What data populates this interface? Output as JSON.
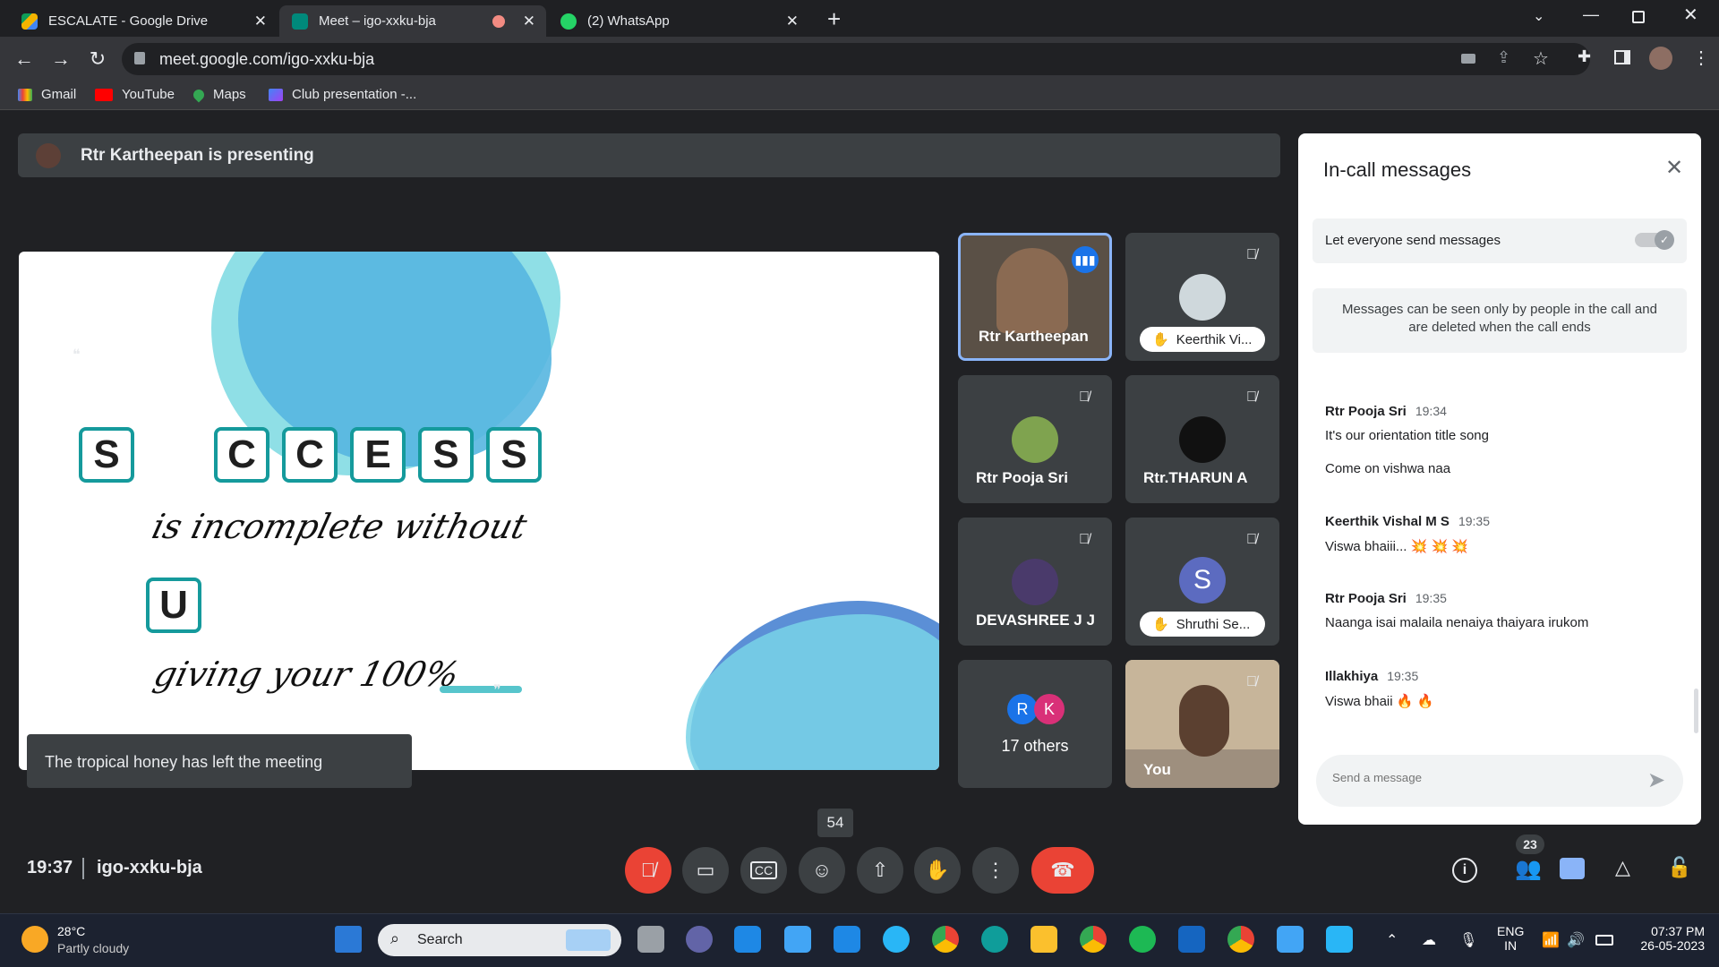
{
  "browser": {
    "tabs": [
      {
        "title": "ESCALATE - Google Drive",
        "close": "✕"
      },
      {
        "title": "Meet – igo-xxku-bja",
        "close": "✕"
      },
      {
        "title": "(2) WhatsApp",
        "close": "✕"
      }
    ],
    "new_tab": "+",
    "url": "meet.google.com/igo-xxku-bja",
    "bookmarks": [
      "Gmail",
      "YouTube",
      "Maps",
      "Club presentation -..."
    ]
  },
  "meet": {
    "presenting_banner": "Rtr Kartheepan is presenting",
    "slide": {
      "letters_row1": [
        "S",
        "C",
        "C",
        "E",
        "S",
        "S"
      ],
      "line1": "is incomplete without",
      "letter_u": "U",
      "line2": "giving your 100%"
    },
    "toast": "The tropical honey has left the meeting",
    "participants": [
      {
        "name": "Rtr Kartheepan"
      },
      {
        "name": "Keerthik Vi..."
      },
      {
        "name": "Rtr Pooja Sri"
      },
      {
        "name": "Rtr.THARUN A"
      },
      {
        "name": "DEVASHREE J J"
      },
      {
        "name": "Shruthi Se...",
        "initial": "S"
      },
      {
        "name": "17 others",
        "initials": [
          "R",
          "K"
        ]
      },
      {
        "name": "You"
      }
    ],
    "time": "19:37",
    "meeting_code": "igo-xxku-bja",
    "count_tooltip": "54",
    "people_badge": "23",
    "accent_red": "#ea4335",
    "accent_blue": "#8ab4f8"
  },
  "panel": {
    "title": "In-call messages",
    "toggle_label": "Let everyone send messages",
    "notice": "Messages can be seen only by people in the call and are deleted when the call ends",
    "messages": [
      {
        "sender": "Rtr Pooja Sri",
        "time": "19:34",
        "lines": [
          "It's our orientation title song",
          "Come on vishwa naa"
        ]
      },
      {
        "sender": "Keerthik Vishal M S",
        "time": "19:35",
        "lines": [
          "Viswa bhaiii... 💥 💥 💥"
        ]
      },
      {
        "sender": "Rtr Pooja Sri",
        "time": "19:35",
        "lines": [
          "Naanga isai malaila nenaiya thaiyara irukom"
        ]
      },
      {
        "sender": "Illakhiya",
        "time": "19:35",
        "lines": [
          "Viswa bhaii 🔥 🔥"
        ]
      }
    ],
    "input_placeholder": "Send a message"
  },
  "taskbar": {
    "weather_temp": "28°C",
    "weather_desc": "Partly cloudy",
    "search_label": "Search",
    "lang1": "ENG",
    "lang2": "IN",
    "clock_time": "07:37 PM",
    "clock_date": "26-05-2023"
  }
}
